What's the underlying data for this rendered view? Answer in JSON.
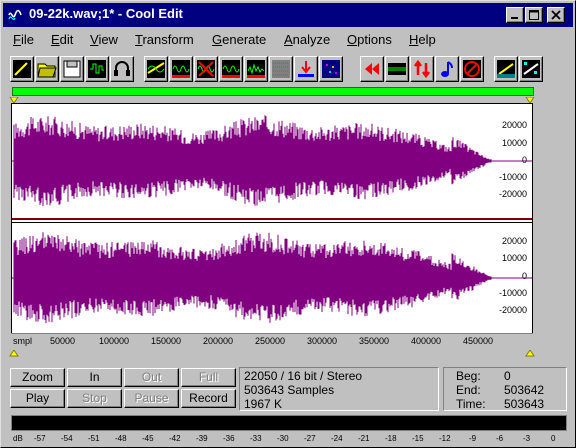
{
  "window": {
    "title": "09-22k.wav;1* - Cool Edit"
  },
  "menu": [
    {
      "label": "File",
      "key": "F",
      "rest": "ile"
    },
    {
      "label": "Edit",
      "key": "E",
      "rest": "dit"
    },
    {
      "label": "View",
      "key": "V",
      "rest": "iew"
    },
    {
      "label": "Transform",
      "key": "T",
      "rest": "ransform"
    },
    {
      "label": "Generate",
      "key": "G",
      "rest": "enerate"
    },
    {
      "label": "Analyze",
      "key": "A",
      "rest": "nalyze"
    },
    {
      "label": "Options",
      "key": "O",
      "rest": "ptions"
    },
    {
      "label": "Help",
      "key": "H",
      "rest": "elp"
    }
  ],
  "toolbar": [
    "new-file-icon",
    "open-file-icon",
    "save-file-icon",
    "cd-audio-icon",
    "headphones-icon",
    "amplify-icon",
    "envelope-icon",
    "invert-icon",
    "filter-icon",
    "noise-reduction-icon",
    "generate-noise-icon",
    "generate-tones-icon",
    "statistics-icon",
    "reverse-icon",
    "silence-icon",
    "stretch-icon",
    "pitch-icon",
    "mute-icon",
    "cue-list-icon",
    "spectral-view-icon"
  ],
  "ruler": {
    "unit": "smpl",
    "ticks": [
      "50000",
      "100000",
      "150000",
      "200000",
      "250000",
      "300000",
      "350000",
      "400000",
      "450000"
    ]
  },
  "channels": {
    "left_scale": [
      "20000",
      "10000",
      "0",
      "-10000",
      "-20000"
    ],
    "right_scale": [
      "20000",
      "10000",
      "0",
      "-10000",
      "-20000"
    ]
  },
  "transport": {
    "zoom": "Zoom",
    "in": "In",
    "out": "Out",
    "full": "Full",
    "play": "Play",
    "stop": "Stop",
    "pause": "Pause",
    "record": "Record"
  },
  "file_info": {
    "format": "22050 / 16 bit / Stereo",
    "samples": "503643 Samples",
    "size": "1967 K"
  },
  "selection": {
    "beg_label": "Beg:",
    "beg_value": "0",
    "end_label": "End:",
    "end_value": "503642",
    "time_label": "Time:",
    "time_value": "503643"
  },
  "meter": {
    "labels": [
      "dB",
      "-57",
      "-54",
      "-51",
      "-48",
      "-45",
      "-42",
      "-39",
      "-36",
      "-33",
      "-30",
      "-27",
      "-24",
      "-21",
      "-18",
      "-15",
      "-12",
      "-9",
      "-6",
      "-3",
      "0"
    ]
  },
  "colors": {
    "waveform": "#800080",
    "overview": "#00ff00",
    "titlebar": "#000080"
  }
}
